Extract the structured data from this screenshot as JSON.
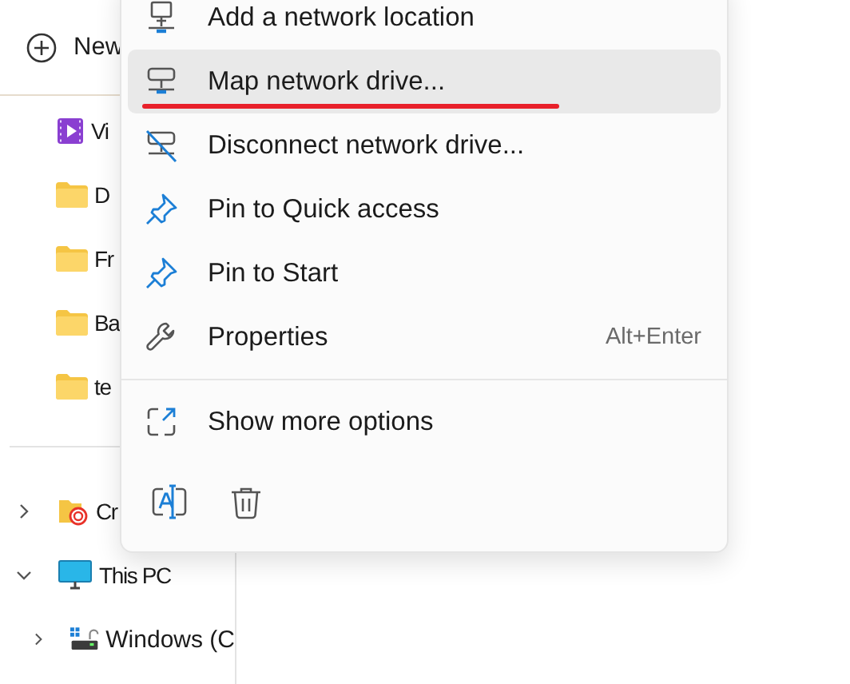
{
  "sidebar": {
    "new_button": {
      "label": "New"
    },
    "quick_items": [
      {
        "label": "Vi",
        "kind": "video"
      },
      {
        "label": "D",
        "kind": "folder"
      },
      {
        "label": "Fr",
        "kind": "folder"
      },
      {
        "label": "Ba",
        "kind": "folder"
      },
      {
        "label": "te",
        "kind": "folder"
      }
    ],
    "tree": [
      {
        "label": "Cr",
        "kind": "cloud-folder",
        "expanded": false
      },
      {
        "label": "This PC",
        "kind": "pc",
        "expanded": true,
        "children": [
          {
            "label": "Windows (C",
            "kind": "drive",
            "expanded": false
          }
        ]
      }
    ]
  },
  "context_menu": {
    "items": [
      {
        "label": "Add a network location",
        "kind": "network-pc",
        "selected": false,
        "underlined": false
      },
      {
        "label": "Map network drive...",
        "kind": "network-drive",
        "selected": true,
        "underlined": true
      },
      {
        "label": "Disconnect network drive...",
        "kind": "disconnect-drive",
        "selected": false,
        "underlined": false
      },
      {
        "label": "Pin to Quick access",
        "kind": "pin",
        "selected": false,
        "underlined": false
      },
      {
        "label": "Pin to Start",
        "kind": "pin",
        "selected": false,
        "underlined": false
      },
      {
        "label": "Properties",
        "kind": "wrench",
        "selected": false,
        "underlined": false,
        "shortcut": "Alt+Enter"
      }
    ],
    "more_item": {
      "label": "Show more options",
      "kind": "expand"
    },
    "actions": [
      {
        "kind": "rename"
      },
      {
        "kind": "delete"
      }
    ]
  }
}
